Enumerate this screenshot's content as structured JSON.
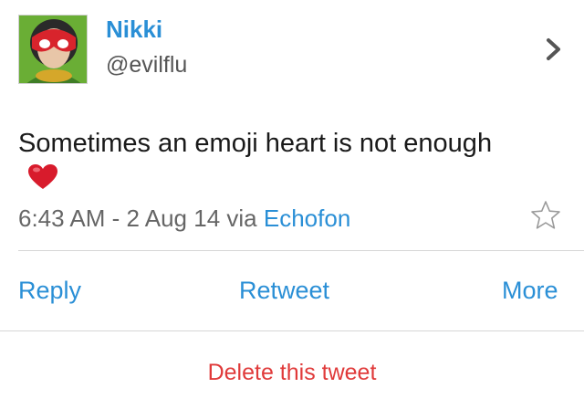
{
  "author": {
    "name": "Nikki",
    "handle": "@evilflu"
  },
  "tweet": {
    "text": "Sometimes an emoji heart is not enough",
    "emoji": "red-heart-emoji",
    "time": "6:43 AM - 2 Aug 14",
    "via_prefix": "via",
    "client": "Echofon"
  },
  "actions": {
    "reply": "Reply",
    "retweet": "Retweet",
    "more": "More"
  },
  "delete_label": "Delete this tweet",
  "icons": {
    "profile": "chevron-right-icon",
    "favorite": "star-outline-icon"
  },
  "colors": {
    "link": "#2a8fd6",
    "destructive": "#e03a3a",
    "heart": "#d81b2c"
  }
}
